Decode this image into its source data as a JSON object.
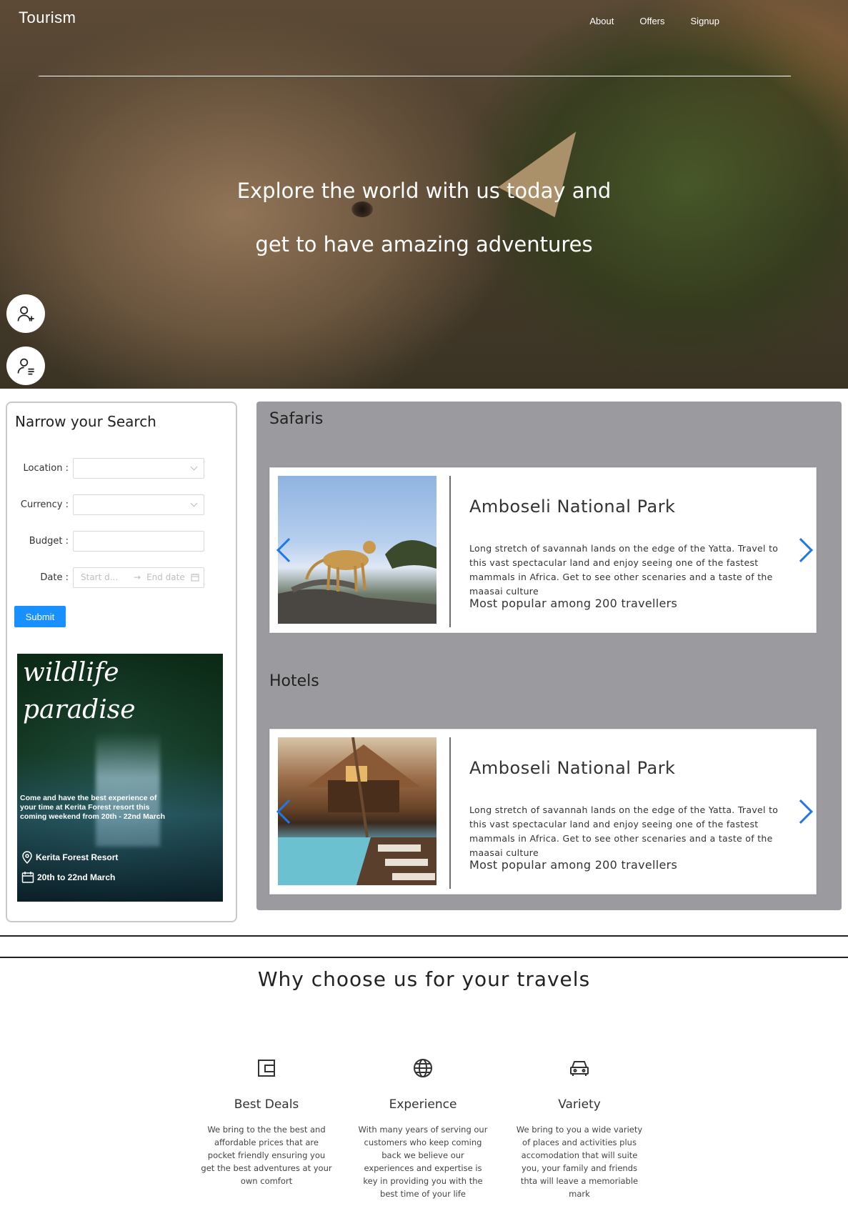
{
  "header": {
    "brand": "Tourism",
    "nav": [
      "About",
      "Offers",
      "Signup"
    ],
    "hero_line1": "Explore the world with us today and",
    "hero_line2": "get to have amazing adventures"
  },
  "sidebar": {
    "title": "Narrow your Search",
    "fields": {
      "location_label": "Location",
      "currency_label": "Currency",
      "budget_label": "Budget",
      "date_label": "Date",
      "start_placeholder": "Start d...",
      "end_placeholder": "End date"
    },
    "submit": "Submit",
    "promo": {
      "line1": "wildlife",
      "line2": "paradise",
      "desc": "Come and have the best experience of your time at Kerita Forest resort this coming weekend from 20th - 22nd March",
      "place": "Kerita Forest Resort",
      "dates": "20th to 22nd March"
    }
  },
  "main": {
    "safaris": {
      "title": "Safaris",
      "card_title": "Amboseli National Park",
      "card_text": "Long stretch of savannah lands on the edge of the Yatta. Travel to this vast spectacular land and enjoy seeing one of the fastest mammals in Africa. Get to see other scenaries and a taste of the maasai culture",
      "card_popular": "Most popular among 200 travellers"
    },
    "hotels": {
      "title": "Hotels",
      "card_title": "Amboseli National Park",
      "card_text": "Long stretch of savannah lands on the edge of the Yatta. Travel to this vast spectacular land and enjoy seeing one of the fastest mammals in Africa. Get to see other scenaries and a taste of the maasai culture",
      "card_popular": "Most popular among 200 travellers"
    }
  },
  "why": {
    "title": "Why choose us for your travels",
    "features": [
      {
        "icon": "wallet-icon",
        "title": "Best Deals",
        "text": "We bring to the the best and affordable prices that are pocket friendly ensuring you get the best adventures at your own comfort"
      },
      {
        "icon": "globe-icon",
        "title": "Experience",
        "text": "With many years of serving our customers who keep coming back we believe our experiences and expertise is key in providing you with the best time of your life"
      },
      {
        "icon": "car-icon",
        "title": "Variety",
        "text": "We bring to you a wide variety of places and activities plus accomodation that will suite you, your family and friends thta will leave a memoriable mark"
      }
    ]
  },
  "colors": {
    "accent": "#1890ff",
    "panel": "#9a9a9f",
    "arrow": "#1f77e8"
  }
}
